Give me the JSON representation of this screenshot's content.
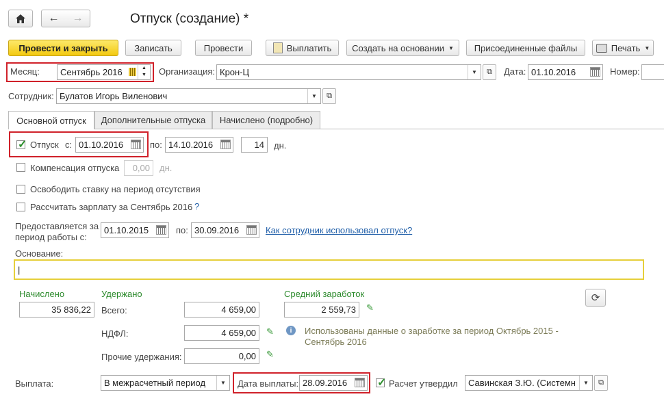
{
  "header": {
    "title": "Отпуск (создание) *"
  },
  "toolbar": {
    "post_close": "Провести и закрыть",
    "save": "Записать",
    "post": "Провести",
    "pay": "Выплатить",
    "create_based": "Создать на основании",
    "attachments": "Присоединенные файлы",
    "print": "Печать"
  },
  "top": {
    "month_label": "Месяц:",
    "month_value": "Сентябрь 2016",
    "org_label": "Организация:",
    "org_value": "Крон-Ц",
    "date_label": "Дата:",
    "date_value": "01.10.2016",
    "number_label": "Номер:",
    "employee_label": "Сотрудник:",
    "employee_value": "Булатов Игорь Виленович"
  },
  "tabs": [
    "Основной отпуск",
    "Дополнительные отпуска",
    "Начислено (подробно)"
  ],
  "main": {
    "vacation_label": "Отпуск",
    "from_label": "с:",
    "from_value": "01.10.2016",
    "to_label": "по:",
    "to_value": "14.10.2016",
    "days_value": "14",
    "days_label": "дн.",
    "compensation_label": "Компенсация отпуска",
    "compensation_value": "0,00",
    "compensation_unit": "дн.",
    "release_rate_label": "Освободить ставку на период отсутствия",
    "calc_salary_label": "Рассчитать зарплату за Сентябрь 2016",
    "help_mark": "?",
    "period_label_1": "Предоставляется за",
    "period_label_2": "период работы с:",
    "period_from": "01.10.2015",
    "period_to_label": "по:",
    "period_to": "30.09.2016",
    "usage_link": "Как сотрудник использовал отпуск?",
    "basis_label": "Основание:",
    "basis_value": "|"
  },
  "totals": {
    "accrued_label": "Начислено",
    "accrued_value": "35 836,22",
    "withheld_label": "Удержано",
    "total_label": "Всего:",
    "total_value": "4 659,00",
    "ndfl_label": "НДФЛ:",
    "ndfl_value": "4 659,00",
    "other_label": "Прочие удержания:",
    "other_value": "0,00",
    "avg_label": "Средний заработок",
    "avg_value": "2 559,73",
    "info_text_1": "Использованы данные о заработке за период Октябрь 2015 -",
    "info_text_2": "Сентябрь 2016"
  },
  "bottom": {
    "payment_label": "Выплата:",
    "payment_value": "В межрасчетный период",
    "pay_date_label": "Дата выплаты:",
    "pay_date_value": "28.09.2016",
    "approved_label": "Расчет утвердил",
    "approver_value": "Савинская З.Ю. (Системн"
  },
  "colors": {
    "accent_yellow": "#f3c911",
    "highlight_red": "#d0212a",
    "green_label": "#2c8a2c",
    "link_blue": "#1f5ea8"
  }
}
